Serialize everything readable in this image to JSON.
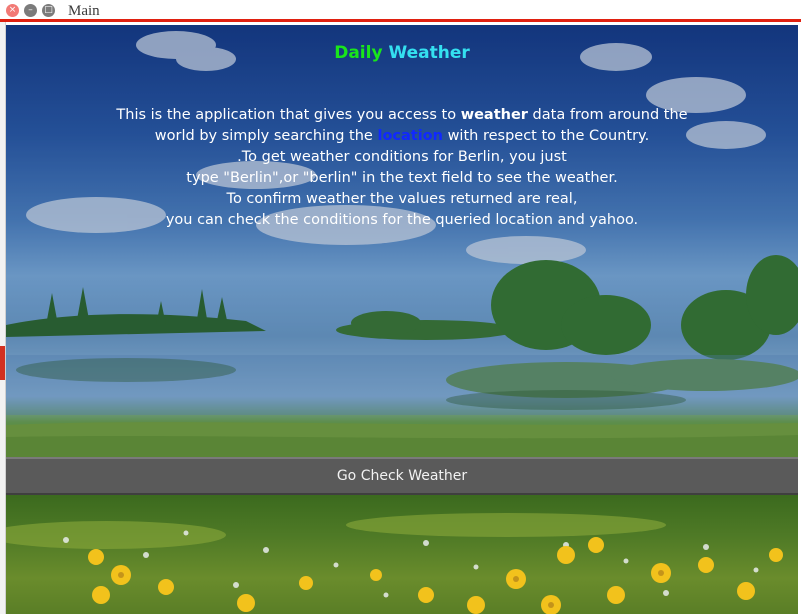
{
  "window": {
    "title": "Main",
    "close_glyph": "×",
    "min_glyph": "–",
    "max_glyph": "□"
  },
  "content": {
    "heading_part1": "Daily",
    "heading_part2": "Weather",
    "desc_line1_pre": "This is the application that gives you access to ",
    "desc_line1_bold": "weather",
    "desc_line1_post": " data from around the",
    "desc_line2_pre": "world by simply searching the ",
    "desc_line2_link": "location",
    "desc_line2_post": " with respect to the Country.",
    "desc_line3": ".To get weather conditions for Berlin, you just",
    "desc_line4": "type \"Berlin\",or \"berlin\" in the text field to see the weather.",
    "desc_line5": "To confirm weather the values returned are real,",
    "desc_line6": "you can check the conditions for the queried location and yahoo."
  },
  "action": {
    "button_label": "Go Check Weather"
  },
  "colors": {
    "heading_part1": "#19e61b",
    "heading_part2": "#34e0f0",
    "location_link": "#1028ff",
    "titlebar_accent": "#e02010",
    "button_bg": "#5a5a5a"
  },
  "icons": {
    "close": "close-icon",
    "minimize": "minimize-icon",
    "maximize": "maximize-icon"
  }
}
